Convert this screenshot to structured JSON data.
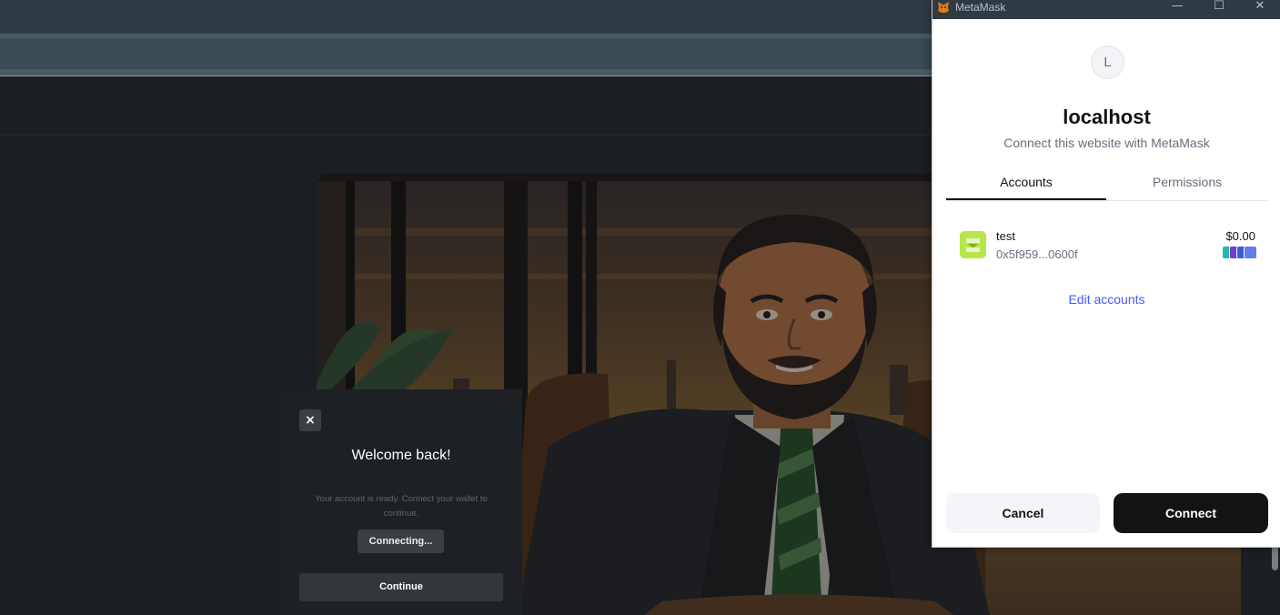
{
  "modal": {
    "close_glyph": "×",
    "title": "Welcome back!",
    "message": "Your account is ready. Connect your wallet to continue.",
    "connecting_label": "Connecting...",
    "continue_label": "Continue"
  },
  "metamask": {
    "window_title": "MetaMask",
    "window_buttons": {
      "minimize": "—",
      "maximize": "☐",
      "close": "✕"
    },
    "site_initial": "L",
    "site_name": "localhost",
    "subtitle": "Connect this website with MetaMask",
    "tabs": [
      {
        "label": "Accounts",
        "active": true
      },
      {
        "label": "Permissions",
        "active": false
      }
    ],
    "account": {
      "name": "test",
      "address": "0x5f959...0600f",
      "balance": "$0.00"
    },
    "edit_accounts_label": "Edit accounts",
    "cancel_label": "Cancel",
    "connect_label": "Connect",
    "colors": {
      "accent": "#4459ff",
      "primary_button": "#121314",
      "account_icon": "#b6e64a"
    }
  }
}
